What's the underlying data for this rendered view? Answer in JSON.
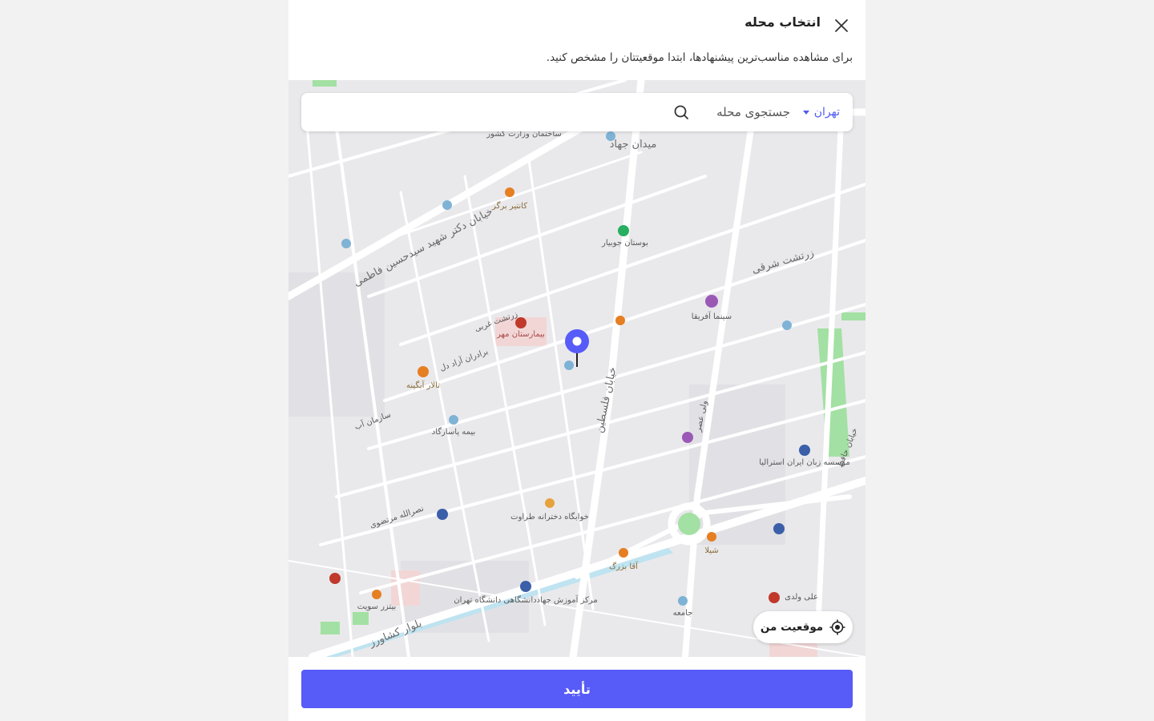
{
  "dialog": {
    "title": "انتخاب محله",
    "subtitle": "برای مشاهده مناسب‌ترین پیشنهادها، ابتدا موقعیتتان را مشخص کنید."
  },
  "search": {
    "city": "تهران",
    "placeholder": "جستجوی محله"
  },
  "map": {
    "my_location_label": "موقعیت من",
    "street_labels": [
      "خیابان دکتر شهید سیدحسین فاطمی",
      "خیابان فلسطین",
      "میدان جهاد",
      "بلوار کشاورز",
      "زرتشت شرقی",
      "زرتشت غربی",
      "ولی عصر",
      "بوستان جوبیار",
      "بیمارستان مهر",
      "تالار آبگینه",
      "سینما آفریقا",
      "خیابان حافظ",
      "موسسه زبان ایران استرالیا",
      "خوابگاه دخترانه طراوت",
      "مرکز آموزش جهاددانشگاهی دانشگاه تهران",
      "بیمه پاسارگاد",
      "ساختمان وزارت کشور",
      "کانتیر برگر",
      "شیلا",
      "آقا بزرگ",
      "بیتزر سویت",
      "علی ولدی",
      "جامعه",
      "برادران آزاد دل",
      "نصرالله مرتضوی",
      "سازمان آب"
    ]
  },
  "footer": {
    "confirm_label": "تأیید"
  },
  "colors": {
    "primary": "#575bf7",
    "link": "#4f5bf0",
    "map_bg": "#e9e9ec",
    "park": "#8fd88f"
  }
}
